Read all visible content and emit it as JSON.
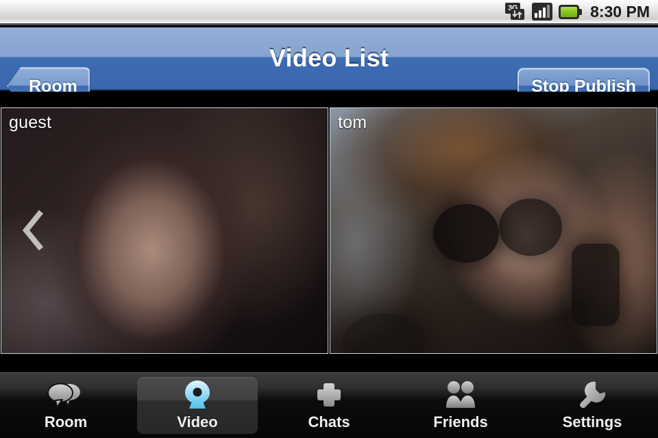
{
  "statusbar": {
    "network_label": "3G",
    "clock": "8:30 PM",
    "icons": [
      "3g-data-icon",
      "signal-bars-icon",
      "battery-icon"
    ]
  },
  "navbar": {
    "back_label": "Room",
    "title": "Video List",
    "action_label": "Stop Publish",
    "accent_top": "#8FABD4",
    "accent_bottom": "#3B68B0"
  },
  "videos": {
    "prev_arrow": "‹",
    "tiles": [
      {
        "label": "guest"
      },
      {
        "label": "tom"
      }
    ]
  },
  "tabbar": {
    "items": [
      {
        "label": "Room",
        "icon": "chat-bubbles-icon",
        "selected": false
      },
      {
        "label": "Video",
        "icon": "webcam-icon",
        "selected": true
      },
      {
        "label": "Chats",
        "icon": "plus-icon",
        "selected": false
      },
      {
        "label": "Friends",
        "icon": "people-icon",
        "selected": false
      },
      {
        "label": "Settings",
        "icon": "wrench-icon",
        "selected": false
      }
    ],
    "selected_color": "#7FD2F2"
  }
}
